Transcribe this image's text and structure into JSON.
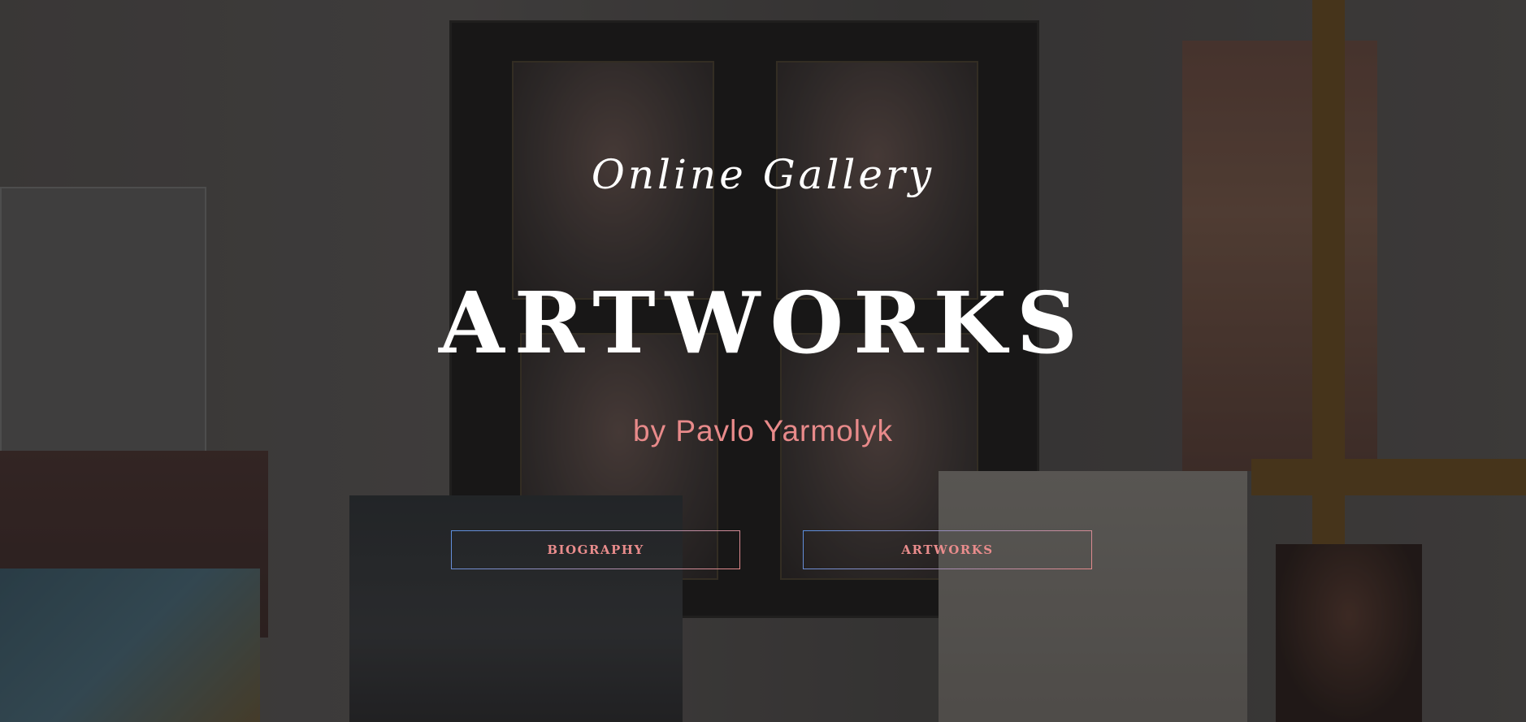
{
  "hero": {
    "subtitle": "Online Gallery",
    "title": "ARTWORKS",
    "author": "by Pavlo Yarmolyk"
  },
  "buttons": {
    "biography_label": "BIOGRAPHY",
    "artworks_label": "ARTWORKS"
  },
  "colors": {
    "accent_pink": "#e88a8a",
    "accent_blue": "#5b8fe0",
    "title_white": "#ffffff",
    "overlay": "rgba(20,18,18,0.42)"
  }
}
